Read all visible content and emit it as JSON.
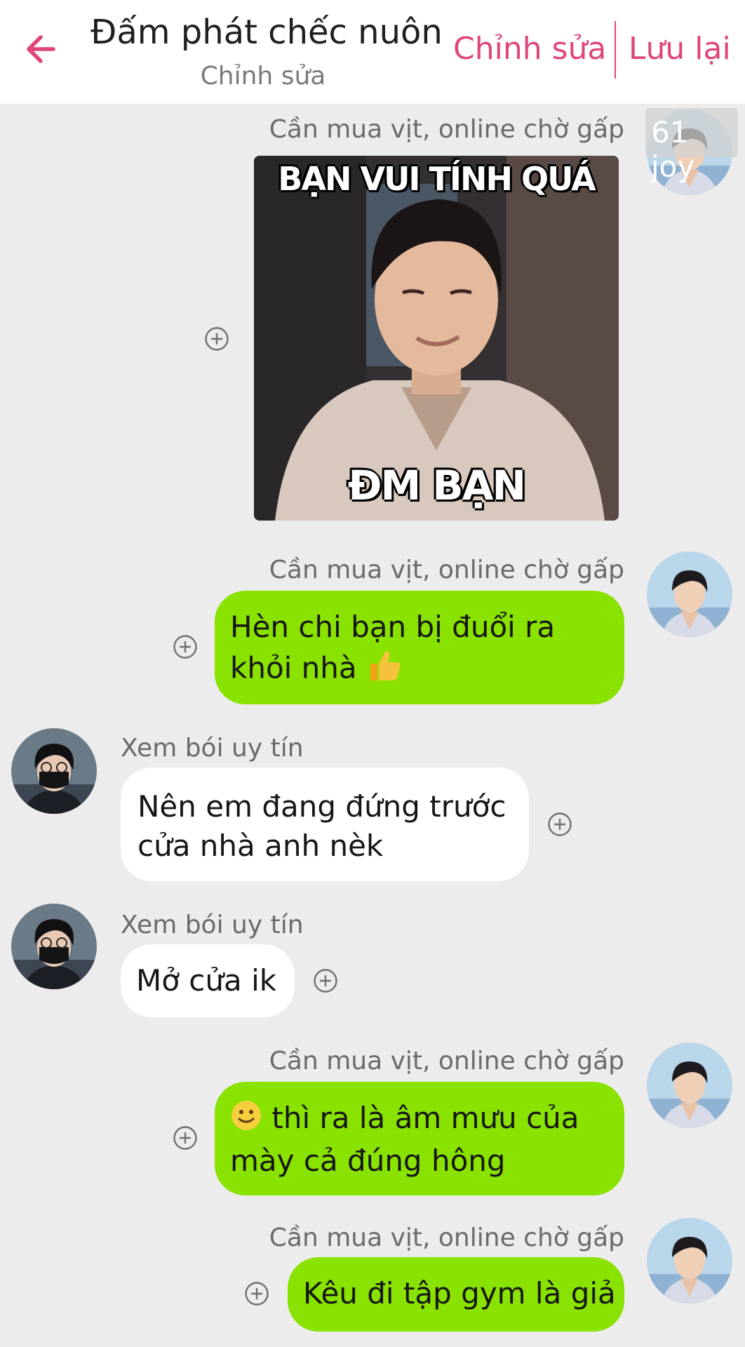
{
  "header": {
    "title": "Đấm phát chếc nuôn",
    "subtitle": "Chỉnh sửa",
    "edit_label": "Chỉnh sửa",
    "save_label": "Lưu lại",
    "accent_color": "#e0457a"
  },
  "badge": {
    "text": "61 joy"
  },
  "meme": {
    "top_text": "BẠN VUI TÍNH QUÁ",
    "bottom_text": "ĐM BẠN"
  },
  "messages": [
    {
      "sender": "Cần mua vịt, online chờ gấp",
      "side": "right",
      "type": "image"
    },
    {
      "sender": "Cần mua vịt, online chờ gấp",
      "side": "right",
      "line1": "Hèn chi bạn bị đuổi ra",
      "line2": "khỏi nhà",
      "emoji": "thumbs-up"
    },
    {
      "sender": "Xem bói uy tín",
      "side": "left",
      "line1": "Nên em đang đứng trước",
      "line2": "cửa nhà anh nèk"
    },
    {
      "sender": "Xem bói uy tín",
      "side": "left",
      "text": "Mở cửa ik"
    },
    {
      "sender": "Cần mua vịt, online chờ gấp",
      "side": "right",
      "emoji": "slight-smile",
      "line1": "thì ra là âm mưu của",
      "line2": "mày cả đúng hông"
    },
    {
      "sender": "Cần mua vịt, online chờ gấp",
      "side": "right",
      "text": "Kêu đi tập gym là giả"
    }
  ],
  "colors": {
    "outgoing_bubble": "#89e200",
    "incoming_bubble": "#ffffff",
    "background": "#ececec"
  }
}
